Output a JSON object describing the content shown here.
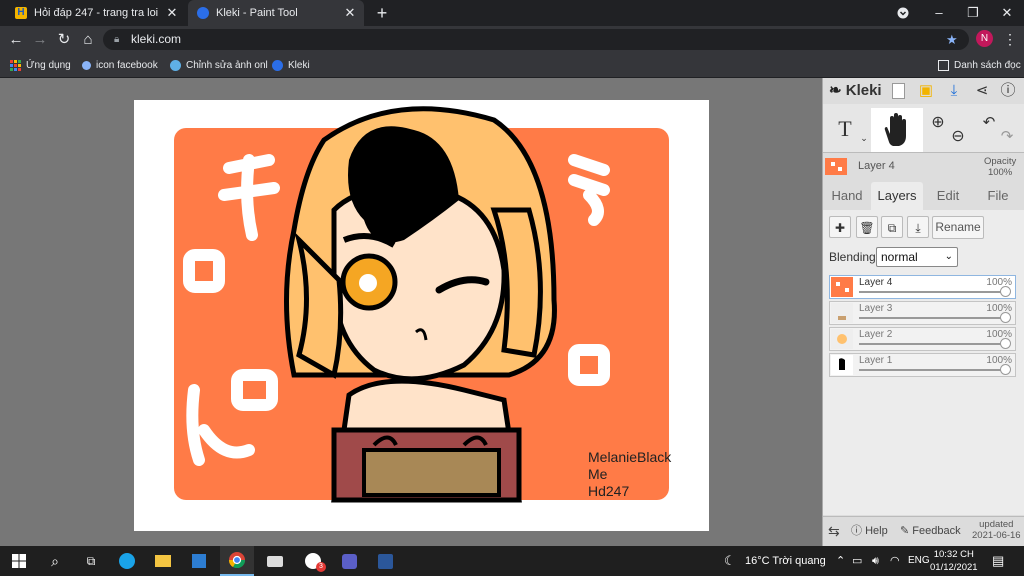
{
  "browser": {
    "tabs": [
      {
        "title": "Hỏi đáp 247 - trang tra loi",
        "active": false,
        "favicon": "h-logo-icon"
      },
      {
        "title": "Kleki - Paint Tool",
        "active": true,
        "favicon": "kleki-icon"
      }
    ],
    "close_glyph": "✕",
    "new_tab_glyph": "+",
    "url": "kleki.com",
    "avatar_initial": "N",
    "bookmarks": [
      {
        "label": "Ứng dụng",
        "icon": "apps-grid-icon"
      },
      {
        "label": "icon facebook",
        "icon": "globe-icon"
      },
      {
        "label": "Chỉnh sửa ảnh onl",
        "icon": "photo-edit-icon"
      },
      {
        "label": "Kleki",
        "icon": "kleki-icon"
      }
    ],
    "reading_list": "Danh sách đọc"
  },
  "canvas": {
    "signature": "MelanieBlack\nMe\nHd247"
  },
  "panel": {
    "logo": "Kleki",
    "current_layer": "Layer 4",
    "opacity_label": "Opacity",
    "opacity_value": "100%",
    "tabs": [
      {
        "label": "Hand",
        "active": false
      },
      {
        "label": "Layers",
        "active": true
      },
      {
        "label": "Edit",
        "active": false
      },
      {
        "label": "File",
        "active": false
      }
    ],
    "rename_label": "Rename",
    "blending_label": "Blending",
    "blending_value": "normal",
    "layers": [
      {
        "name": "Layer 4",
        "opacity": "100%",
        "selected": true
      },
      {
        "name": "Layer 3",
        "opacity": "100%",
        "selected": false
      },
      {
        "name": "Layer 2",
        "opacity": "100%",
        "selected": false
      },
      {
        "name": "Layer 1",
        "opacity": "100%",
        "selected": false
      }
    ],
    "help_label": "Help",
    "feedback_label": "Feedback",
    "updated_label": "updated",
    "updated_date": "2021-06-16"
  },
  "taskbar": {
    "weather": "16°C  Trời quang",
    "language": "ENG",
    "time": "10:32 CH",
    "date": "01/12/2021",
    "notif_badge": "3"
  },
  "colors": {
    "accent_orange": "#ff7b47",
    "hair": "#ffc16e",
    "skin": "#ffe3c9"
  }
}
